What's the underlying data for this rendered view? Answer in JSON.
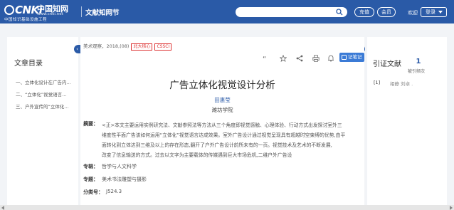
{
  "header": {
    "logo_mark": "CNKi",
    "logo_cn": "中国知网",
    "logo_url": "www.cnki.net",
    "logo_sub": "中国知识基础设施工程",
    "section_title": "文献知网节",
    "search_placeholder": "",
    "recharge_label": "充值",
    "member_label": "会员",
    "welcome_text": "欢迎",
    "login_label": "登录"
  },
  "toc": {
    "title": "文章目录",
    "items": [
      "一、立体化设计在广告内...",
      "二、“立体化”视觉语言...",
      "三、户外宣传的“立体化..."
    ]
  },
  "article": {
    "meta_source": "美术观察，2018,(08)",
    "tags": [
      "北大核心",
      "CSSCI"
    ],
    "note_label": "记笔记",
    "title": "广告立体化视觉设计分析",
    "author": "田惠莹",
    "affiliation": "潍坊学院",
    "abstract_label": "摘要：",
    "abstract_lines": [
      "<正>本文主要运用实例研究法、文献参照法等方法从三个角度即视觉感触、心理体验、行动方式出发探讨室外三",
      "维度性平面广告该如何运用“立体化”视觉语言达成效果。室外广告设计通过视觉呈现具有超越时空束缚的优势,由平",
      "面转化到立体达到三维及以上的存在形态,翻开了户外广告设计前所未有的一页。视觉技术及艺术的不断发展,",
      "改变了信息输送的方式。过去以文字为主要载体的传媒遇到巨大市场危机,二维户外广告设"
    ],
    "topic_label": "专辑：",
    "topic_value": "哲学与人文科学",
    "subject_label": "专题：",
    "subject_value": "美术书法雕塑与摄影",
    "classno_label": "分类号：",
    "classno_value": "J524.3"
  },
  "citation": {
    "title": "引证文献",
    "count": "1",
    "count_sub": "被引频次",
    "index": "[1]",
    "authors": "相静  刘卓 ."
  },
  "colors": {
    "brand_blue": "#2a5aa7",
    "tag_red": "#dd3333"
  }
}
